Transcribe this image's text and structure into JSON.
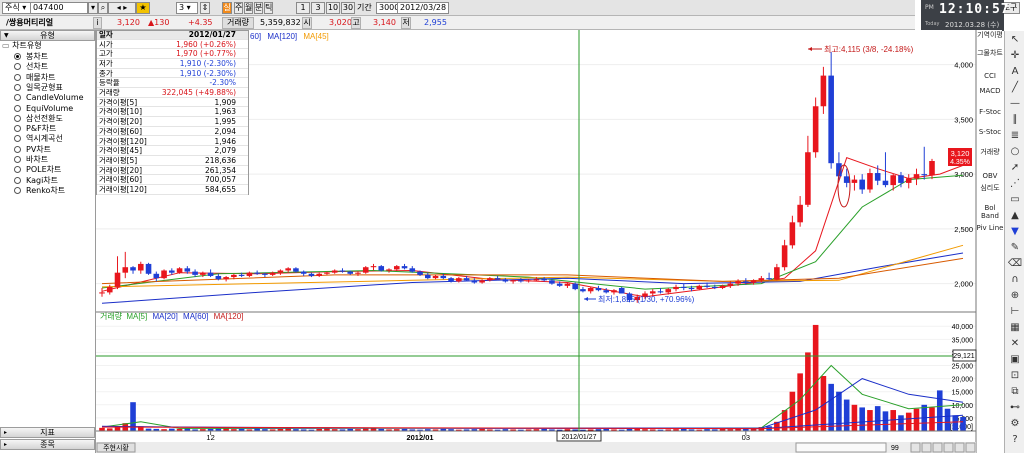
{
  "toolbar": {
    "market_select": "주식",
    "code_input": "047400",
    "period_value": "3",
    "refresh_label": "실",
    "period_buttons": [
      "주",
      "월",
      "분",
      "틱"
    ],
    "interval_buttons": [
      "1",
      "3",
      "10",
      "30"
    ],
    "lookback_label": "기간",
    "lookback_value": "3000",
    "date_value": "2012/03/28",
    "tools_label": "도구"
  },
  "quote": {
    "name": "/쌍용머티리얼",
    "price": "3,120",
    "change": "▲130",
    "change_pct": "+4.35",
    "volume_label": "거래량",
    "volume": "5,359,832",
    "open_label": "시",
    "open": "3,020",
    "high_label": "고",
    "high": "3,140",
    "low_label": "저",
    "low": "2,955"
  },
  "clock": {
    "ampm": "PM",
    "time": "12:10:57",
    "today_label": "Today",
    "date": "2012.03.28 (수)"
  },
  "left_panel": {
    "header": "유형",
    "root": "차트유형",
    "types": [
      "봉차트",
      "선차트",
      "매물차트",
      "일목균형표",
      "CandleVolume",
      "EquiVolume",
      "삼선전환도",
      "P&F차트",
      "역시계곡선",
      "PV차트",
      "바차트",
      "POLE차트",
      "Kagi차트",
      "Renko차트"
    ],
    "selected_index": 0,
    "indicator_tab": "지표",
    "stock_tab": "종목"
  },
  "info_box": {
    "header_key": "일자",
    "header_value": "2012/01/27",
    "rows": [
      {
        "k": "시가",
        "v": "1,960 (+0.26%)"
      },
      {
        "k": "고가",
        "v": "1,970 (+0.77%)"
      },
      {
        "k": "저가",
        "v": "1,910 (-2.30%)"
      },
      {
        "k": "종가",
        "v": "1,910 (-2.30%)"
      },
      {
        "k": "등락율",
        "v": "-2.30%"
      },
      {
        "k": "거래량",
        "v": "322,045 (+49.88%)"
      },
      {
        "k": "가격이평[5]",
        "v": "1,909"
      },
      {
        "k": "가격이평[10]",
        "v": "1,963"
      },
      {
        "k": "가격이평[20]",
        "v": "1,995"
      },
      {
        "k": "가격이평[60]",
        "v": "2,094"
      },
      {
        "k": "가격이평[120]",
        "v": "1,946"
      },
      {
        "k": "가격이평[45]",
        "v": "2,079"
      },
      {
        "k": "거래이평[5]",
        "v": "218,636"
      },
      {
        "k": "거래이평[20]",
        "v": "261,354"
      },
      {
        "k": "거래이평[60]",
        "v": "700,057"
      },
      {
        "k": "거래이평[120]",
        "v": "584,655"
      }
    ]
  },
  "price_legend": {
    "ma_partial": "60]",
    "ma120": "MA[120]",
    "ma45": "MA[45]"
  },
  "volume_legend": {
    "label": "거래량",
    "ma5": "MA[5]",
    "ma20": "MA[20]",
    "ma60": "MA[60]",
    "ma120": "MA[120]"
  },
  "annotations": {
    "high": "최고:4,115 (3/8, -24.18%)",
    "low": "최저:1,825 (1/30, +70.96%)",
    "current_price": "3,120",
    "current_pct": "4.35%",
    "crosshair_volume": "29,121",
    "crosshair_date": "2012/01/27"
  },
  "indicators": [
    "기역이평",
    "그물차트",
    "CCI",
    "MACD",
    "F-Stoc",
    "S-Stoc",
    "거래량",
    "OBV",
    "심리도",
    "Bol Band",
    "Piv Line"
  ],
  "bottom": {
    "history_button": "주현시황",
    "zoom_value": "99"
  },
  "colors": {
    "up": "#e8161d",
    "down": "#1f3fd6",
    "ma5": "#e8161d",
    "ma20": "#2aa02a",
    "ma60": "#1a2ec8",
    "ma120": "#f29a00",
    "ma45": "#d85a00",
    "crosshair": "#2a9a2a"
  },
  "chart_data": {
    "type": "candlestick",
    "y_ticks": [
      "4,000",
      "3,500",
      "3,000",
      "2,500",
      "2,000"
    ],
    "x_labels": [
      "12",
      "2012/01",
      "03"
    ],
    "ylim": [
      1750,
      4280
    ],
    "candles": [
      [
        1910,
        1960,
        1880,
        1920
      ],
      [
        1920,
        1990,
        1900,
        1970
      ],
      [
        1970,
        2250,
        1950,
        2100
      ],
      [
        2100,
        2290,
        2050,
        2150
      ],
      [
        2150,
        2160,
        2090,
        2120
      ],
      [
        2120,
        2200,
        2090,
        2180
      ],
      [
        2180,
        2190,
        2080,
        2090
      ],
      [
        2090,
        2110,
        2020,
        2050
      ],
      [
        2050,
        2130,
        2040,
        2120
      ],
      [
        2120,
        2140,
        2080,
        2100
      ],
      [
        2100,
        2150,
        2090,
        2140
      ],
      [
        2140,
        2160,
        2090,
        2110
      ],
      [
        2110,
        2130,
        2060,
        2080
      ],
      [
        2080,
        2110,
        2060,
        2100
      ],
      [
        2100,
        2130,
        2060,
        2070
      ],
      [
        2070,
        2090,
        2030,
        2040
      ],
      [
        2040,
        2070,
        2020,
        2060
      ],
      [
        2060,
        2090,
        2040,
        2080
      ],
      [
        2080,
        2100,
        2060,
        2070
      ],
      [
        2070,
        2110,
        2060,
        2100
      ],
      [
        2100,
        2120,
        2080,
        2090
      ],
      [
        2090,
        2100,
        2060,
        2080
      ],
      [
        2080,
        2110,
        2070,
        2100
      ],
      [
        2100,
        2130,
        2080,
        2120
      ],
      [
        2120,
        2150,
        2100,
        2140
      ],
      [
        2140,
        2150,
        2100,
        2110
      ],
      [
        2110,
        2120,
        2070,
        2090
      ],
      [
        2090,
        2100,
        2060,
        2070
      ],
      [
        2070,
        2100,
        2060,
        2090
      ],
      [
        2090,
        2110,
        2080,
        2100
      ],
      [
        2100,
        2130,
        2090,
        2120
      ],
      [
        2120,
        2140,
        2100,
        2110
      ],
      [
        2110,
        2120,
        2080,
        2090
      ],
      [
        2090,
        2110,
        2070,
        2100
      ],
      [
        2100,
        2160,
        2090,
        2150
      ],
      [
        2150,
        2180,
        2120,
        2160
      ],
      [
        2160,
        2170,
        2110,
        2120
      ],
      [
        2120,
        2140,
        2100,
        2130
      ],
      [
        2130,
        2170,
        2120,
        2160
      ],
      [
        2160,
        2180,
        2130,
        2140
      ],
      [
        2140,
        2160,
        2100,
        2110
      ],
      [
        2110,
        2120,
        2070,
        2080
      ],
      [
        2080,
        2100,
        2040,
        2050
      ],
      [
        2050,
        2080,
        2040,
        2070
      ],
      [
        2070,
        2090,
        2040,
        2050
      ],
      [
        2050,
        2060,
        2010,
        2020
      ],
      [
        2020,
        2060,
        2010,
        2050
      ],
      [
        2050,
        2070,
        2020,
        2030
      ],
      [
        2030,
        2050,
        2000,
        2010
      ],
      [
        2010,
        2040,
        2000,
        2030
      ],
      [
        2030,
        2060,
        2020,
        2050
      ],
      [
        2050,
        2070,
        2030,
        2040
      ],
      [
        2040,
        2050,
        2010,
        2020
      ],
      [
        2020,
        2040,
        2000,
        2030
      ],
      [
        2030,
        2050,
        2010,
        2020
      ],
      [
        2020,
        2040,
        2010,
        2030
      ],
      [
        2030,
        2060,
        2020,
        2040
      ],
      [
        2040,
        2060,
        2020,
        2030
      ],
      [
        2030,
        2040,
        1990,
        2000
      ],
      [
        2000,
        2020,
        1970,
        1980
      ],
      [
        1980,
        2010,
        1960,
        2000
      ],
      [
        2000,
        2010,
        1940,
        1950
      ],
      [
        1950,
        1970,
        1920,
        1930
      ],
      [
        1930,
        1970,
        1910,
        1960
      ],
      [
        1960,
        1980,
        1930,
        1940
      ],
      [
        1940,
        1960,
        1910,
        1920
      ],
      [
        1920,
        1950,
        1900,
        1940
      ],
      [
        1960,
        1970,
        1910,
        1910
      ],
      [
        1910,
        1920,
        1830,
        1850
      ],
      [
        1850,
        1900,
        1825,
        1880
      ],
      [
        1880,
        1930,
        1860,
        1910
      ],
      [
        1910,
        1950,
        1890,
        1930
      ],
      [
        1930,
        1960,
        1910,
        1920
      ],
      [
        1920,
        1960,
        1900,
        1950
      ],
      [
        1950,
        1990,
        1930,
        1970
      ],
      [
        1970,
        2000,
        1940,
        1960
      ],
      [
        1960,
        1980,
        1930,
        1950
      ],
      [
        1950,
        1990,
        1940,
        1980
      ],
      [
        1980,
        2010,
        1960,
        1970
      ],
      [
        1970,
        1990,
        1950,
        1960
      ],
      [
        1960,
        1990,
        1950,
        1980
      ],
      [
        1980,
        2020,
        1960,
        2000
      ],
      [
        2000,
        2040,
        1980,
        2020
      ],
      [
        2020,
        2050,
        1990,
        2010
      ],
      [
        2010,
        2040,
        1990,
        2030
      ],
      [
        2030,
        2070,
        2010,
        2050
      ],
      [
        2050,
        2100,
        2030,
        2040
      ],
      [
        2040,
        2180,
        2030,
        2150
      ],
      [
        2150,
        2400,
        2120,
        2350
      ],
      [
        2350,
        2620,
        2320,
        2560
      ],
      [
        2560,
        2800,
        2520,
        2720
      ],
      [
        2720,
        3350,
        2700,
        3200
      ],
      [
        3200,
        3700,
        3150,
        3620
      ],
      [
        3620,
        3980,
        3550,
        3900
      ],
      [
        3900,
        4115,
        3050,
        3100
      ],
      [
        3100,
        3200,
        2950,
        2980
      ],
      [
        2980,
        3050,
        2880,
        2920
      ],
      [
        2920,
        2990,
        2850,
        2950
      ],
      [
        2950,
        3000,
        2820,
        2860
      ],
      [
        2860,
        3050,
        2830,
        3010
      ],
      [
        3010,
        3080,
        2900,
        2940
      ],
      [
        2940,
        3200,
        2880,
        2900
      ],
      [
        2900,
        3000,
        2850,
        2990
      ],
      [
        2990,
        3020,
        2880,
        2920
      ],
      [
        2920,
        3000,
        2870,
        2960
      ],
      [
        2960,
        3050,
        2900,
        3000
      ],
      [
        3000,
        3250,
        2950,
        2990
      ],
      [
        2990,
        3140,
        2955,
        3120
      ]
    ],
    "ma_lines": {
      "ma5": [
        [
          0,
          1930
        ],
        [
          10,
          2100
        ],
        [
          20,
          2090
        ],
        [
          30,
          2110
        ],
        [
          40,
          2120
        ],
        [
          50,
          2040
        ],
        [
          60,
          2010
        ],
        [
          66,
          1930
        ],
        [
          70,
          1880
        ],
        [
          80,
          1970
        ],
        [
          88,
          2050
        ],
        [
          92,
          2300
        ],
        [
          96,
          3150
        ],
        [
          100,
          3050
        ],
        [
          104,
          2960
        ],
        [
          108,
          3000
        ],
        [
          111,
          3080
        ]
      ],
      "ma20": [
        [
          0,
          1960
        ],
        [
          15,
          2090
        ],
        [
          35,
          2120
        ],
        [
          55,
          2060
        ],
        [
          70,
          1950
        ],
        [
          85,
          2000
        ],
        [
          92,
          2200
        ],
        [
          98,
          2700
        ],
        [
          104,
          2950
        ],
        [
          111,
          2990
        ]
      ],
      "ma60": [
        [
          0,
          1820
        ],
        [
          20,
          1920
        ],
        [
          40,
          2010
        ],
        [
          60,
          2050
        ],
        [
          75,
          2000
        ],
        [
          90,
          2020
        ],
        [
          100,
          2150
        ],
        [
          111,
          2280
        ]
      ],
      "ma120": [
        [
          0,
          1970
        ],
        [
          20,
          2000
        ],
        [
          40,
          2030
        ],
        [
          60,
          2060
        ],
        [
          80,
          2020
        ],
        [
          95,
          2030
        ],
        [
          111,
          2350
        ]
      ],
      "ma45": [
        [
          0,
          2000
        ],
        [
          30,
          2080
        ],
        [
          60,
          2080
        ],
        [
          80,
          2020
        ],
        [
          95,
          2050
        ],
        [
          111,
          2230
        ]
      ]
    },
    "volume_ticks": [
      "40,000",
      "35,000",
      "30,000",
      "25,000",
      "20,000",
      "15,000",
      "10,000",
      "5,000",
      "[x1000]"
    ],
    "volume_max": 42000,
    "volumes": [
      1200,
      1000,
      1500,
      3000,
      11000,
      1800,
      900,
      800,
      700,
      900,
      800,
      1100,
      600,
      700,
      800,
      900,
      1000,
      700,
      800,
      600,
      900,
      700,
      600,
      800,
      900,
      700,
      600,
      500,
      800,
      900,
      700,
      600,
      800,
      700,
      900,
      1000,
      800,
      600,
      700,
      800,
      600,
      500,
      700,
      600,
      800,
      700,
      500,
      600,
      700,
      800,
      600,
      500,
      700,
      600,
      500,
      600,
      700,
      800,
      600,
      500,
      700,
      600,
      500,
      600,
      700,
      800,
      600,
      500,
      1200,
      900,
      700,
      600,
      500,
      600,
      700,
      800,
      600,
      500,
      700,
      600,
      800,
      700,
      900,
      1000,
      1200,
      1500,
      1800,
      3500,
      8000,
      15000,
      22000,
      30000,
      40500,
      21000,
      18000,
      15000,
      12000,
      10000,
      9000,
      8000,
      9500,
      7500,
      8000,
      6000,
      7000,
      8500,
      10000,
      9000,
      15500,
      8500,
      6000,
      5359
    ],
    "vol_ma_lines": {
      "ma5": [
        [
          0,
          1500
        ],
        [
          5,
          3500
        ],
        [
          10,
          1000
        ],
        [
          85,
          1200
        ],
        [
          90,
          12000
        ],
        [
          94,
          25000
        ],
        [
          98,
          14000
        ],
        [
          104,
          8500
        ],
        [
          111,
          10000
        ]
      ],
      "ma20": [
        [
          0,
          1800
        ],
        [
          20,
          1200
        ],
        [
          85,
          1100
        ],
        [
          92,
          8000
        ],
        [
          98,
          20000
        ],
        [
          104,
          14000
        ],
        [
          111,
          11000
        ]
      ],
      "ma60": [
        [
          0,
          1600
        ],
        [
          50,
          1000
        ],
        [
          85,
          900
        ],
        [
          111,
          6000
        ]
      ],
      "ma120": [
        [
          0,
          1500
        ],
        [
          85,
          900
        ],
        [
          111,
          3500
        ]
      ]
    }
  }
}
